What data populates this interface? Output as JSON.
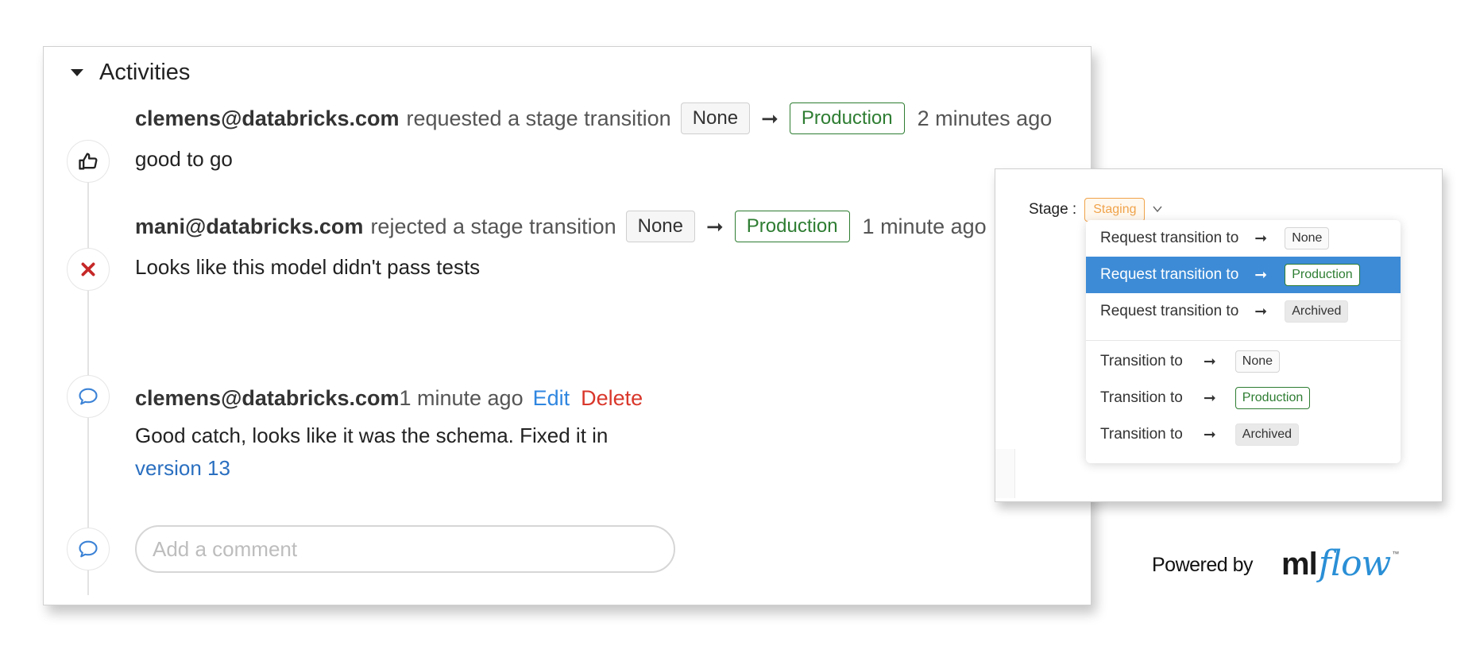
{
  "activities": {
    "title": "Activities",
    "entries": [
      {
        "user": "clemens@databricks.com",
        "action": "requested a stage transition",
        "from": "None",
        "to": "Production",
        "time": "2 minutes ago",
        "comment": "good to go",
        "icon": "thumbs-up-icon"
      },
      {
        "user": "mani@databricks.com",
        "action": "rejected a stage transition",
        "from": "None",
        "to": "Production",
        "time": "1 minute ago",
        "comment": "Looks like this model didn't pass tests",
        "icon": "reject-x-icon"
      },
      {
        "user": "clemens@databricks.com",
        "time": "1 minute ago",
        "edit_label": "Edit",
        "delete_label": "Delete",
        "comment_line1": "Good catch, looks like it was the schema. Fixed it in",
        "comment_link": "version 13",
        "icon": "comment-icon"
      }
    ],
    "comment_placeholder": "Add a comment"
  },
  "stage_menu": {
    "label": "Stage :",
    "current": "Staging",
    "items": [
      {
        "label": "Request transition to",
        "target": "None",
        "selected": false
      },
      {
        "label": "Request transition to",
        "target": "Production",
        "selected": true
      },
      {
        "label": "Request transition to",
        "target": "Archived",
        "selected": false
      },
      {
        "label": "Transition to",
        "target": "None",
        "selected": false
      },
      {
        "label": "Transition to",
        "target": "Production",
        "selected": false
      },
      {
        "label": "Transition to",
        "target": "Archived",
        "selected": false
      }
    ]
  },
  "footer": {
    "powered_by": "Powered by",
    "logo_ml": "ml",
    "logo_flow": "flow",
    "logo_tm": "™"
  },
  "colors": {
    "production": "#2e7d32",
    "staging": "#f0a34a",
    "selected": "#3d8bd6",
    "link": "#2a6fc0",
    "delete": "#d9372b",
    "reject": "#c62828",
    "comment_icon": "#3b82d6"
  }
}
